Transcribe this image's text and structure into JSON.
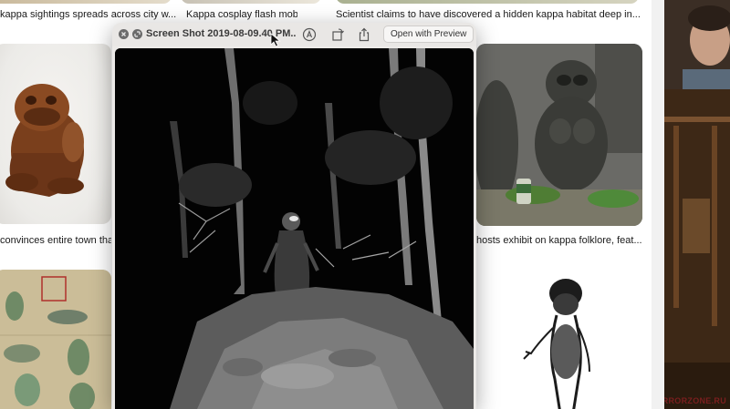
{
  "articles": [
    {
      "caption": "kappa sightings spreads across city w..."
    },
    {
      "caption": "Kappa cosplay flash mob sur..."
    },
    {
      "caption": "Scientist claims to have discovered a hidden kappa habitat deep in..."
    },
    {
      "caption": "convinces entire town tha"
    },
    {
      "caption": "hosts exhibit on kappa folklore, feat..."
    }
  ],
  "quicklook": {
    "title": "Screen Shot 2019-08-09.40 PM....",
    "open_button": "Open with Preview"
  },
  "icons": {
    "close": "close-icon",
    "fullscreen": "fullscreen-icon",
    "markup": "markup-icon",
    "rotate": "rotate-icon",
    "share": "share-icon",
    "cursor": "cursor-icon"
  },
  "watermark": "HORRORZONE.RU",
  "colors": {
    "window_chrome": "#e9e7e5",
    "image_bg": "#020202",
    "watermark": "#7a1e1e"
  }
}
